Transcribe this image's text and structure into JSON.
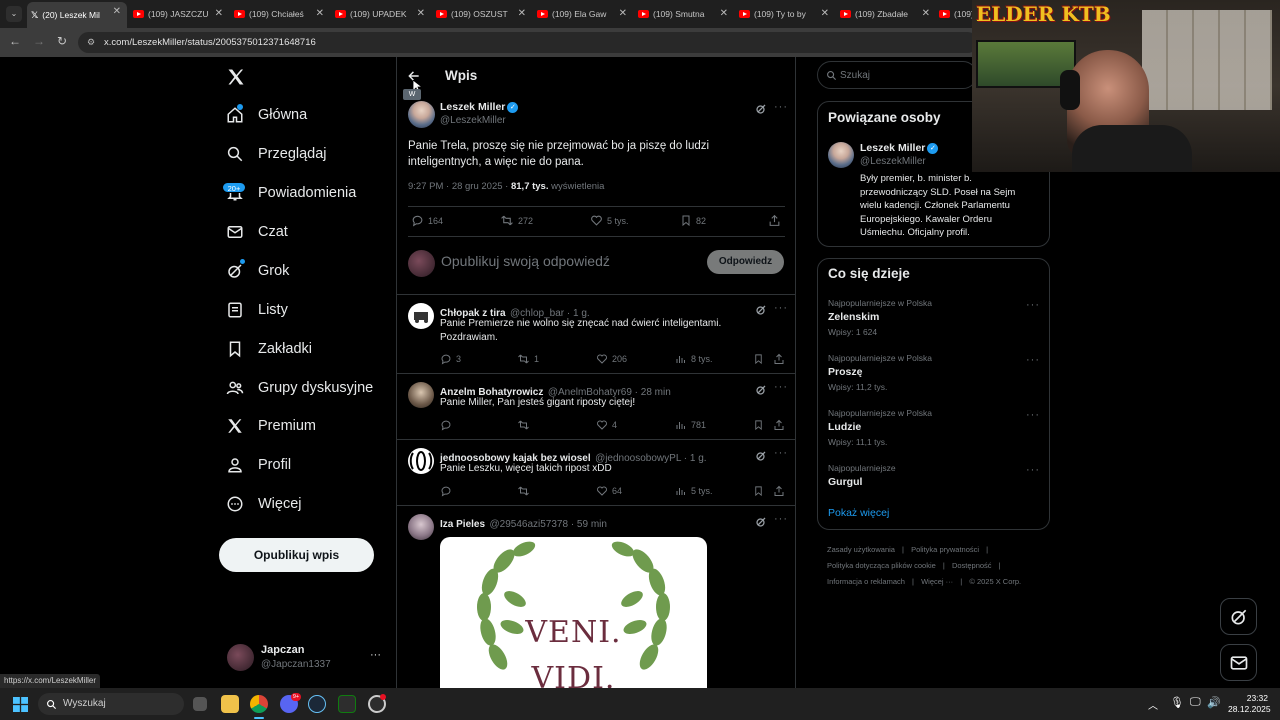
{
  "browser": {
    "tabs": [
      {
        "label": "(20) Leszek Mil",
        "active": true,
        "favicon": "x-icon"
      },
      {
        "label": "(109) JASZCZU",
        "favicon": "youtube-icon"
      },
      {
        "label": "(109) Chciałeś",
        "favicon": "youtube-icon"
      },
      {
        "label": "(109) UPADEK",
        "favicon": "youtube-icon"
      },
      {
        "label": "(109) OSZUST",
        "favicon": "youtube-icon"
      },
      {
        "label": "(109) Ela Gaw",
        "favicon": "youtube-icon"
      },
      {
        "label": "(109) Smutna",
        "favicon": "youtube-icon"
      },
      {
        "label": "(109) Ty to by",
        "favicon": "youtube-icon"
      },
      {
        "label": "(109) Zbadałe",
        "favicon": "youtube-icon"
      },
      {
        "label": "(109)",
        "favicon": "youtube-icon"
      }
    ],
    "url": "x.com/LeszekMiller/status/2005375012371648716",
    "status_url": "https://x.com/LeszekMiller"
  },
  "sidebar": {
    "items": [
      {
        "label": "Główna",
        "icon": "home-icon"
      },
      {
        "label": "Przeglądaj",
        "icon": "search-icon"
      },
      {
        "label": "Powiadomienia",
        "icon": "bell-icon",
        "badge": "20+"
      },
      {
        "label": "Czat",
        "icon": "mail-icon"
      },
      {
        "label": "Grok",
        "icon": "grok-icon"
      },
      {
        "label": "Listy",
        "icon": "list-icon"
      },
      {
        "label": "Zakładki",
        "icon": "bookmark-icon"
      },
      {
        "label": "Grupy dyskusyjne",
        "icon": "people-icon"
      },
      {
        "label": "Premium",
        "icon": "x-icon"
      },
      {
        "label": "Profil",
        "icon": "person-icon"
      },
      {
        "label": "Więcej",
        "icon": "more-circle-icon"
      }
    ],
    "post_button": "Opublikuj wpis",
    "account": {
      "name": "Japczan",
      "handle": "@Japczan1337"
    }
  },
  "main": {
    "header_title": "Wpis",
    "back_tooltip": "W",
    "post": {
      "author": "Leszek Miller",
      "handle": "@LeszekMiller",
      "text_line1": "Panie Trela, proszę się nie przejmować bo ja piszę do ludzi",
      "text_line2": "inteligentnych, a więc nie do pana.",
      "time": "9:27 PM · 28 gru 2025 ·",
      "views_count": "81,7 tys.",
      "views_label": "wyświetlenia",
      "replies": "164",
      "reposts": "272",
      "likes": "5 tys.",
      "bookmarks": "82"
    },
    "composer": {
      "placeholder": "Opublikuj swoją odpowiedź",
      "button": "Odpowiedz"
    },
    "replies": [
      {
        "name": "Chłopak z tira",
        "meta": "@chlop_bar · 1 g.",
        "line1": "Panie Premierze nie wolno się znęcać nad ćwierć inteligentami.",
        "line2": "Pozdrawiam.",
        "replies": "3",
        "reposts": "1",
        "likes": "206",
        "views": "8 tys."
      },
      {
        "name": "Anzelm Bohatyrowicz",
        "meta": "@AnelmBohatyr69 · 28 min",
        "line1": "Panie Miller, Pan jesteś gigant riposty ciętej!",
        "replies": "",
        "reposts": "",
        "likes": "4",
        "views": "781"
      },
      {
        "name": "jednoosobowy kajak bez wiosel",
        "meta": "@jednoosobowyPL · 1 g.",
        "line1": "Panie Leszku, więcej takich ripost xDD",
        "replies": "",
        "reposts": "",
        "likes": "64",
        "views": "5 tys."
      },
      {
        "name": "Iza Pieles",
        "meta": "@29546azi57378 · 59 min",
        "image_text1": "VENI.",
        "image_text2": "VIDI."
      }
    ]
  },
  "right": {
    "search_placeholder": "Szukaj",
    "related": {
      "title": "Powiązane osoby",
      "name": "Leszek Miller",
      "handle": "@LeszekMiller",
      "bio": [
        "Były premier, b. minister b.",
        "przewodniczący SLD. Poseł na Sejm",
        "wielu kadencji. Członek Parlamentu",
        "Europejskiego. Kawaler Orderu",
        "Uśmiechu. Oficjalny profil."
      ]
    },
    "trends": {
      "title": "Co się dzieje",
      "items": [
        {
          "category": "Najpopularniejsze w Polska",
          "name": "Zelenskim",
          "count": "Wpisy: 1 624"
        },
        {
          "category": "Najpopularniejsze w Polska",
          "name": "Proszę",
          "count": "Wpisy: 11,2 tys."
        },
        {
          "category": "Najpopularniejsze w Polska",
          "name": "Ludzie",
          "count": "Wpisy: 11,1 tys."
        },
        {
          "category": "Najpopularniejsze",
          "name": "Gurgul",
          "count": ""
        }
      ],
      "show_more": "Pokaż więcej"
    },
    "footer": {
      "row1": [
        "Zasady użytkowania",
        "Polityka prywatności"
      ],
      "row2": [
        "Polityka dotycząca plików cookie",
        "Dostępność"
      ],
      "row3": [
        "Informacja o reklamach",
        "Więcej ···",
        "© 2025 X Corp."
      ]
    }
  },
  "overlay": {
    "streamer_logo": "ELDER KTB"
  },
  "taskbar": {
    "search_placeholder": "Wyszukaj",
    "time": "23:32",
    "date": "28.12.2025",
    "discord_badge": "9+"
  },
  "colors": {
    "accent": "#1d9bf0",
    "background": "#000000",
    "muted": "#71767b",
    "border": "#2f3336"
  }
}
